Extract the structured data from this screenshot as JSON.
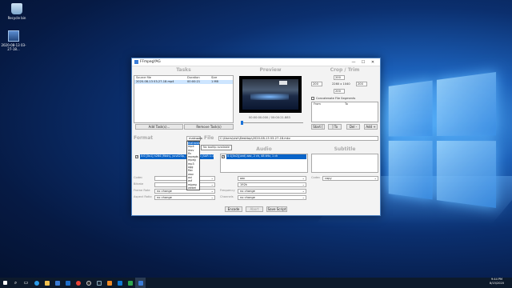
{
  "desktop": {
    "icons": [
      {
        "label": "Recycle bin",
        "icon": "recycle-bin-icon"
      },
      {
        "label": "2020-08-13 03-27-18...",
        "icon": "video-file-icon"
      }
    ]
  },
  "window": {
    "title": "FFmpegYAG",
    "controls": [
      "—",
      "☐",
      "✕"
    ]
  },
  "tasks": {
    "heading": "Tasks",
    "columns": [
      "Source file",
      "Duration",
      "Size"
    ],
    "rows": [
      {
        "source": "2020-08-13 03-27-18.mp4",
        "duration": "00:00:21",
        "size": "1 MB"
      }
    ],
    "add_label": "Add Task(s)...",
    "remove_label": "Remove Task(s)"
  },
  "preview": {
    "heading": "Preview",
    "timecode": "00:00:00.000 / 00:00:21.883"
  },
  "crop": {
    "heading": "Crop / Trim",
    "top": "200",
    "left": "200",
    "right": "200",
    "bottom": "200",
    "size_label": "2260 x 1040",
    "concat_label": "Concatenate File Segments",
    "from_label": "From",
    "to_label": "To",
    "buttons": [
      "Start [",
      "] To",
      "Del -",
      "Add +"
    ]
  },
  "format": {
    "label": "Format",
    "value": "matroska",
    "file_label": "File",
    "file_value": "C:\\Users\\vish\\Desktop\\2020-08-13 03-27-18.mkv",
    "options": [
      "matroska",
      "mp4",
      "mov",
      "flv",
      "mpegts",
      "mpeg",
      "mp3",
      "ogg",
      "flac",
      "wav",
      "avi",
      "asf",
      "mjpeg",
      "webm"
    ],
    "tooltip": "No tooltip available"
  },
  "video": {
    "stream": "0:0 [0x1] h264 (Main), yuv420p, 1920x1080 [SAR 1:1], 30 fps",
    "codec_label": "Codec",
    "codec_value": "",
    "bitrate_label": "Bitrate",
    "bitrate_value": "",
    "fps_label": "Frame Rate",
    "fps_value": "no change",
    "aspect_label": "Aspect Ratio",
    "aspect_value": "no change"
  },
  "audio": {
    "heading": "Audio",
    "stream": "0:1[0x2](und) aac, 2 ch, 48 kHz, 1 ch",
    "codec_value": "aac",
    "bitrate_value": "192k",
    "freq_label": "Frequency",
    "freq_value": "no change",
    "channels_label": "Channels",
    "channels_value": "no change"
  },
  "subtitle": {
    "heading": "Subtitle",
    "codec_label": "Codec",
    "codec_value": "copy"
  },
  "actions": {
    "encode": "Encode",
    "abort": "Abort",
    "save_script": "Save Script"
  },
  "taskbar": {
    "time": "9:44 PM",
    "date": "8/15/2020"
  }
}
